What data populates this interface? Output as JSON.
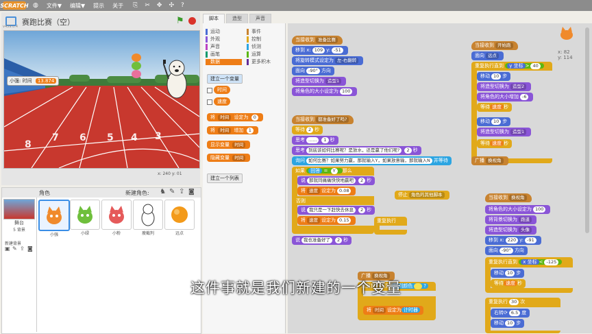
{
  "menubar": {
    "logo": "SCRATCH",
    "items": [
      "文件▼",
      "编辑▼",
      "提示",
      "关于"
    ]
  },
  "stage": {
    "title": "赛跑比赛（空）",
    "version": "v459.0.4",
    "variable_label": "小强: 时间",
    "variable_value": "13.874",
    "coords": "x: 240  y: 01"
  },
  "sprites": {
    "header_label": "角色",
    "new_sprite_label": "新建角色:",
    "stage_label": "舞台",
    "stage_sub": "5 背景",
    "new_backdrop_label": "新建背景",
    "items": [
      {
        "name": "小强"
      },
      {
        "name": "小绿"
      },
      {
        "name": "小粉"
      },
      {
        "name": "瘦截判"
      },
      {
        "name": "远点"
      }
    ]
  },
  "tabs": [
    "脚本",
    "造型",
    "声音"
  ],
  "categories": {
    "left": [
      "运动",
      "外观",
      "声音",
      "画笔",
      "数据"
    ],
    "right": [
      "事件",
      "控制",
      "侦测",
      "运算",
      "更多积木"
    ],
    "selected": "数据"
  },
  "palette": {
    "make_var_button": "建立一个变量",
    "var_time": "时间",
    "var_speed": "速度",
    "set_block": {
      "a": "将",
      "var": "时间",
      "b": "设定为",
      "v": "0"
    },
    "change_block": {
      "a": "将",
      "var": "时间",
      "b": "增加",
      "v": "1"
    },
    "show_block": {
      "a": "显示变量",
      "var": "时间"
    },
    "hide_block": {
      "a": "隐藏变量",
      "var": "时间"
    },
    "make_list_button": "建立一个列表"
  },
  "sprite_info": {
    "x": "x: 82",
    "y": "y: 114"
  },
  "scripts": {
    "s1": {
      "hat": "当接收到",
      "hat_msg": "准备比赛",
      "goto": [
        "移到 x:",
        "109",
        "y:",
        "-51"
      ],
      "rot": [
        "将旋转模式设定为",
        "左-右翻转"
      ],
      "dir": [
        "面向",
        "-90°",
        "方向"
      ],
      "cos": [
        "将造型切换为",
        "造型1"
      ],
      "size": [
        "将角色的大小设定为",
        "100"
      ]
    },
    "s2": {
      "hat": "当接收到",
      "hat_msg": "都准备好了吗?",
      "wait": [
        "等待",
        "2",
        "秒"
      ],
      "think1": [
        "思考",
        "......",
        "1",
        "秒"
      ],
      "think2": [
        "思考",
        "到底该如何比赛呢？是放水，还是赢了他们呢?",
        "2",
        "秒"
      ],
      "ask": [
        "询问",
        "如何比赛？如果努力赢，那就输入Y，如果放意输，那就输入N",
        "并等待"
      ],
      "if": [
        "如果",
        "回答",
        "=",
        "Y",
        "那么"
      ],
      "say1": [
        "说",
        "那就同痛痛快快地赢吧",
        "2",
        "秒"
      ],
      "set1": [
        "将",
        "速度",
        "设定为",
        "0.08"
      ],
      "else": "否则",
      "say2": [
        "说",
        "我只是一下赶快去休息",
        "2",
        "秒"
      ],
      "set2": [
        "将",
        "速度",
        "设定为",
        "0.15"
      ],
      "say3": [
        "说",
        "我也准备好了",
        "2",
        "秒"
      ],
      "stop": [
        "停止",
        "角色的其他脚本"
      ],
      "repeat": "重复执行"
    },
    "s3": {
      "broadcast": [
        "广播",
        "换视角"
      ],
      "until": [
        "重复执行直到",
        "碰到颜色",
        "?"
      ],
      "set": [
        "将",
        "时间",
        "设定为",
        "计时器"
      ]
    },
    "s4": {
      "hat": "当接收到",
      "hat_msg": "开始跑",
      "dir": [
        "面向",
        "远点"
      ],
      "until": [
        "重复执行直到",
        "y 坐标",
        ">",
        "40"
      ],
      "move1": [
        "移动",
        "10",
        "步"
      ],
      "cos1": [
        "将造型切换为",
        "造型2"
      ],
      "size": [
        "将角色的大小增加",
        "-6"
      ],
      "wait1": [
        "等待",
        "速度",
        "秒"
      ],
      "move2": [
        "移动",
        "10",
        "步"
      ],
      "cos2": [
        "将造型切换为",
        "造型1"
      ],
      "wait2": [
        "等待",
        "速度",
        "秒"
      ],
      "broadcast": [
        "广播",
        "换视角"
      ]
    },
    "s5": {
      "hat": "当接收到",
      "hat_msg": "换视角",
      "size": [
        "将角色的大小设定为",
        "100"
      ],
      "bg": [
        "将背景切换为",
        "跑道"
      ],
      "cos": [
        "将造型切换为",
        "头像"
      ],
      "goto": [
        "移到 x:",
        "220",
        "y:",
        "-91"
      ],
      "dir": [
        "面向",
        "-90°",
        "方向"
      ],
      "until": [
        "重复执行直到",
        "x 坐标",
        "<",
        "-125"
      ],
      "move": [
        "移动",
        "10",
        "步"
      ],
      "wait": [
        "等待",
        "速度",
        "秒"
      ],
      "repeat": [
        "重复执行",
        "30",
        "次"
      ],
      "turn": [
        "右转",
        "⟳",
        "6.5",
        "度"
      ],
      "move2": [
        "移动",
        "10",
        "步"
      ]
    }
  },
  "subtitle": "这件事就是我们新建的一个变量"
}
